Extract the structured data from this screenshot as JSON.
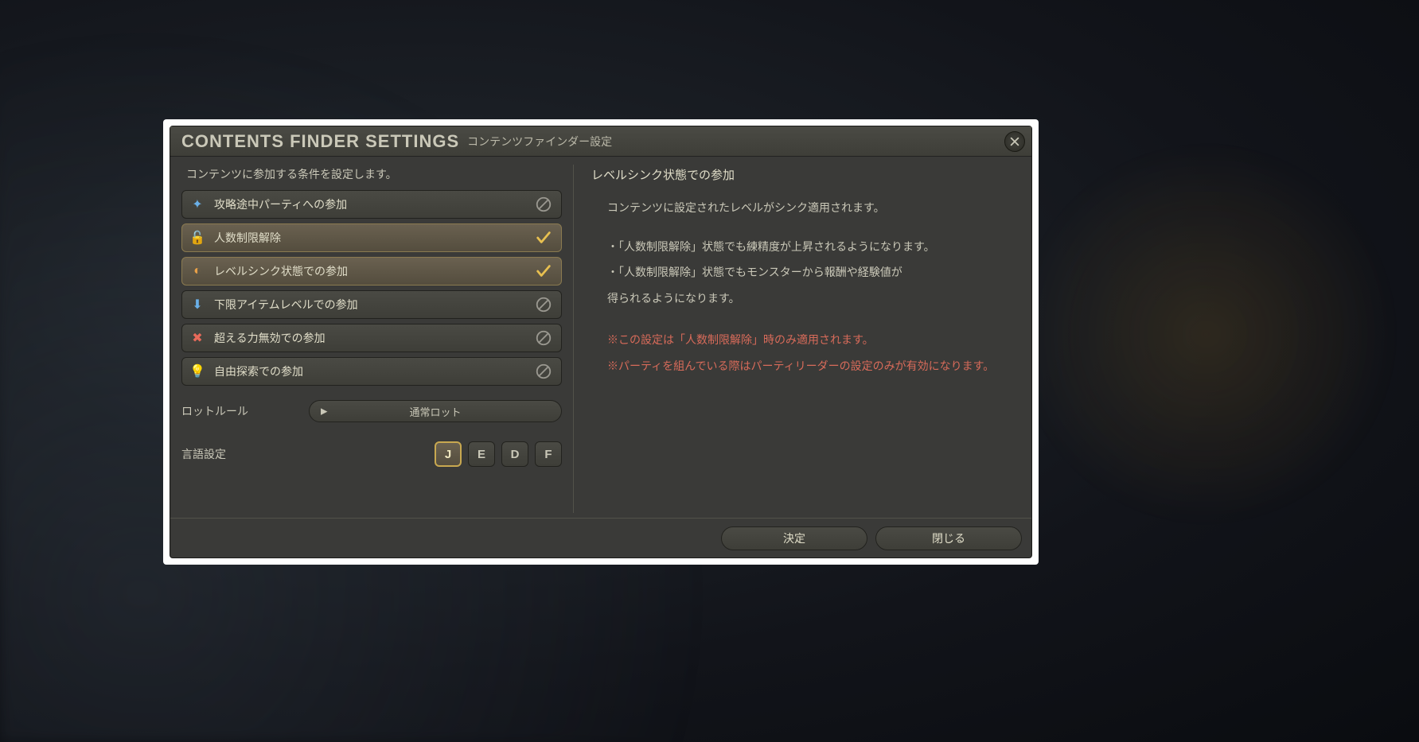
{
  "title": {
    "en": "CONTENTS FINDER SETTINGS",
    "jp": "コンテンツファインダー設定"
  },
  "instruction": "コンテンツに参加する条件を設定します。",
  "options": [
    {
      "label": "攻略途中パーティへの参加",
      "checked": false
    },
    {
      "label": "人数制限解除",
      "checked": true
    },
    {
      "label": "レベルシンク状態での参加",
      "checked": true
    },
    {
      "label": "下限アイテムレベルでの参加",
      "checked": false
    },
    {
      "label": "超える力無効での参加",
      "checked": false
    },
    {
      "label": "自由探索での参加",
      "checked": false
    }
  ],
  "loot": {
    "label": "ロットルール",
    "value": "通常ロット"
  },
  "language": {
    "label": "言語設定",
    "buttons": [
      "J",
      "E",
      "D",
      "F"
    ],
    "active": "J"
  },
  "detail": {
    "title": "レベルシンク状態での参加",
    "line1": "コンテンツに設定されたレベルがシンク適用されます。",
    "bullet1": "「人数制限解除」状態でも練精度が上昇されるようになります。",
    "bullet2a": "「人数制限解除」状態でもモンスターから報酬や経験値が",
    "bullet2b": "得られるようになります。",
    "warn1": "この設定は「人数制限解除」時のみ適用されます。",
    "warn2": "パーティを組んでいる際はパーティリーダーの設定のみが有効になります。"
  },
  "footer": {
    "confirm": "決定",
    "close": "閉じる"
  }
}
